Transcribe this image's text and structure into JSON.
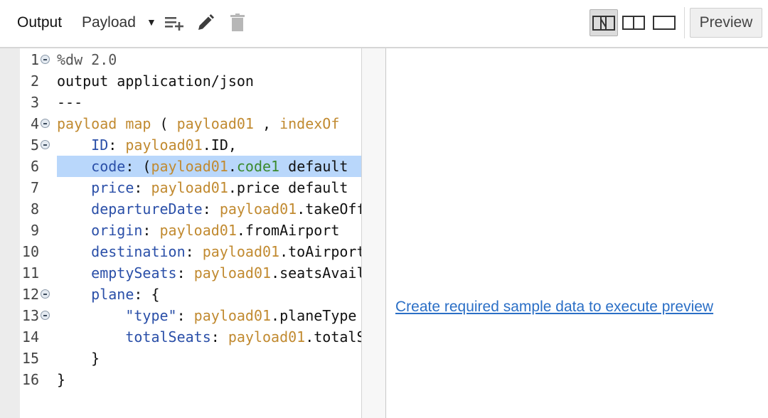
{
  "toolbar": {
    "output_label": "Output",
    "payload_label": "Payload",
    "icons": [
      "add-list-icon",
      "pencil-icon",
      "trash-icon",
      "layout-single-pane-icon",
      "layout-split-pane-icon",
      "layout-full-pane-icon"
    ],
    "preview_label": "Preview"
  },
  "editor": {
    "highlighted_line": 6,
    "lines": [
      {
        "num": "1",
        "fold": true,
        "tokens": [
          {
            "t": "%dw 2.0",
            "c": "dir"
          }
        ]
      },
      {
        "num": "2",
        "fold": false,
        "tokens": [
          {
            "t": "output application/json",
            "c": ""
          }
        ]
      },
      {
        "num": "3",
        "fold": false,
        "tokens": [
          {
            "t": "---",
            "c": ""
          }
        ]
      },
      {
        "num": "4",
        "fold": true,
        "tokens": [
          {
            "t": "payload map",
            "c": "kw"
          },
          {
            "t": " ( ",
            "c": ""
          },
          {
            "t": "payload01",
            "c": "var"
          },
          {
            "t": " , ",
            "c": ""
          },
          {
            "t": "indexOf",
            "c": "var"
          }
        ]
      },
      {
        "num": "5",
        "fold": true,
        "tokens": [
          {
            "t": "    ",
            "c": ""
          },
          {
            "t": "ID",
            "c": "key"
          },
          {
            "t": ": ",
            "c": ""
          },
          {
            "t": "payload01",
            "c": "var"
          },
          {
            "t": ".ID,",
            "c": ""
          }
        ]
      },
      {
        "num": "6",
        "fold": false,
        "tokens": [
          {
            "t": "    ",
            "c": ""
          },
          {
            "t": "code",
            "c": "key"
          },
          {
            "t": ": (",
            "c": ""
          },
          {
            "t": "payload01",
            "c": "var"
          },
          {
            "t": ".",
            "c": ""
          },
          {
            "t": "code1",
            "c": "fld"
          },
          {
            "t": " default",
            "c": ""
          }
        ]
      },
      {
        "num": "7",
        "fold": false,
        "tokens": [
          {
            "t": "    ",
            "c": ""
          },
          {
            "t": "price",
            "c": "key"
          },
          {
            "t": ": ",
            "c": ""
          },
          {
            "t": "payload01",
            "c": "var"
          },
          {
            "t": ".price default",
            "c": ""
          }
        ]
      },
      {
        "num": "8",
        "fold": false,
        "tokens": [
          {
            "t": "    ",
            "c": ""
          },
          {
            "t": "departureDate",
            "c": "key"
          },
          {
            "t": ": ",
            "c": ""
          },
          {
            "t": "payload01",
            "c": "var"
          },
          {
            "t": ".takeOff",
            "c": ""
          }
        ]
      },
      {
        "num": "9",
        "fold": false,
        "tokens": [
          {
            "t": "    ",
            "c": ""
          },
          {
            "t": "origin",
            "c": "key"
          },
          {
            "t": ": ",
            "c": ""
          },
          {
            "t": "payload01",
            "c": "var"
          },
          {
            "t": ".fromAirport",
            "c": ""
          }
        ]
      },
      {
        "num": "10",
        "fold": false,
        "tokens": [
          {
            "t": "    ",
            "c": ""
          },
          {
            "t": "destination",
            "c": "key"
          },
          {
            "t": ": ",
            "c": ""
          },
          {
            "t": "payload01",
            "c": "var"
          },
          {
            "t": ".toAirport",
            "c": ""
          }
        ]
      },
      {
        "num": "11",
        "fold": false,
        "tokens": [
          {
            "t": "    ",
            "c": ""
          },
          {
            "t": "emptySeats",
            "c": "key"
          },
          {
            "t": ": ",
            "c": ""
          },
          {
            "t": "payload01",
            "c": "var"
          },
          {
            "t": ".seatsAvailable",
            "c": ""
          }
        ]
      },
      {
        "num": "12",
        "fold": true,
        "tokens": [
          {
            "t": "    ",
            "c": ""
          },
          {
            "t": "plane",
            "c": "key"
          },
          {
            "t": ": {",
            "c": ""
          }
        ]
      },
      {
        "num": "13",
        "fold": true,
        "tokens": [
          {
            "t": "        ",
            "c": ""
          },
          {
            "t": "\"type\"",
            "c": "str"
          },
          {
            "t": ": ",
            "c": ""
          },
          {
            "t": "payload01",
            "c": "var"
          },
          {
            "t": ".planeType",
            "c": ""
          }
        ]
      },
      {
        "num": "14",
        "fold": false,
        "tokens": [
          {
            "t": "        ",
            "c": ""
          },
          {
            "t": "totalSeats",
            "c": "key"
          },
          {
            "t": ": ",
            "c": ""
          },
          {
            "t": "payload01",
            "c": "var"
          },
          {
            "t": ".totalSeats",
            "c": ""
          }
        ]
      },
      {
        "num": "15",
        "fold": false,
        "tokens": [
          {
            "t": "    }",
            "c": ""
          }
        ]
      },
      {
        "num": "16",
        "fold": false,
        "tokens": [
          {
            "t": "}",
            "c": ""
          }
        ]
      }
    ]
  },
  "preview_pane": {
    "link_text": "Create required sample data to execute preview"
  }
}
